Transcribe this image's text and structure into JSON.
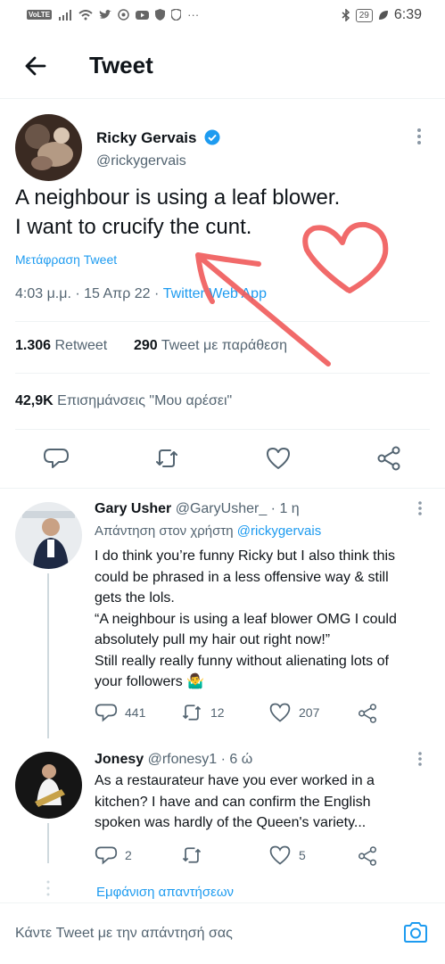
{
  "status_bar": {
    "network_badge": "VoLTE",
    "battery": "29",
    "time": "6:39"
  },
  "header": {
    "title": "Tweet"
  },
  "tweet": {
    "author_name": "Ricky Gervais",
    "author_handle": "@rickygervais",
    "text_line1": "A neighbour is using a leaf blower.",
    "text_line2": "I want to crucify the cunt.",
    "translate_label": "Μετάφραση Tweet",
    "timestamp": "4:03 μ.μ. · 15 Απρ 22 · ",
    "source": "Twitter Web App",
    "retweets_count": "1.306",
    "retweets_label": "Retweet",
    "quotes_count": "290",
    "quotes_label": "Tweet με παράθεση",
    "likes_count": "42,9K",
    "likes_label": "Επισημάνσεις \"Μου αρέσει\""
  },
  "replies": [
    {
      "name": "Gary Usher",
      "handle": "@GaryUsher_",
      "time": "· 1 η",
      "reply_to_prefix": "Απάντηση στον χρήστη ",
      "reply_to_handle": "@rickygervais",
      "lines": [
        "I do think you’re funny Ricky but I also think this",
        "could be phrased in a less offensive way & still",
        "gets the lols.",
        "“A neighbour is using a leaf blower OMG I could",
        "absolutely pull my hair out right now!”",
        "Still really really funny without alienating lots of",
        "your followers 🤷‍♂️"
      ],
      "reply_count": "441",
      "retweet_count": "12",
      "like_count": "207"
    },
    {
      "name": "Jonesy",
      "handle": "@rfonesy1",
      "time": "· 6 ώ",
      "lines": [
        "As a restaurateur have you ever worked in a",
        "kitchen? I have and can confirm the English",
        "spoken was hardly of the Queen's variety..."
      ],
      "reply_count": "2",
      "like_count": "5"
    }
  ],
  "show_replies_label": "Εμφάνιση απαντήσεων",
  "composer": {
    "placeholder": "Κάντε Tweet με την απάντησή σας"
  },
  "colors": {
    "accent": "#1d9bf0",
    "annotation": "#f05a5a"
  }
}
